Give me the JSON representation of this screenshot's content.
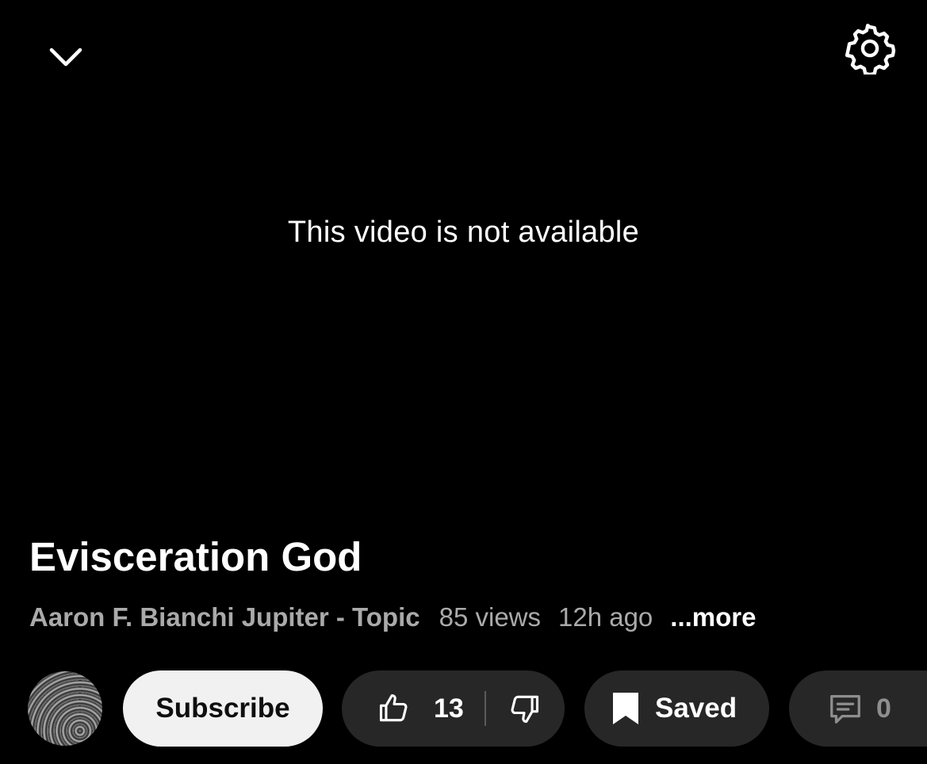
{
  "header": {
    "collapse_icon": "chevron-down-icon",
    "settings_icon": "gear-icon"
  },
  "player": {
    "message": "This video is not available"
  },
  "video": {
    "title": "Evisceration God",
    "channel": "Aaron F. Bianchi Jupiter - Topic",
    "views": "85 views",
    "age": "12h ago",
    "more_label": "...more"
  },
  "actions": {
    "subscribe_label": "Subscribe",
    "like_count": "13",
    "save_label": "Saved",
    "comments_count": "0"
  },
  "colors": {
    "background": "#000000",
    "pill_background": "#272727",
    "subscribe_background": "#f1f1f1",
    "meta_text": "#aaaaaa"
  }
}
